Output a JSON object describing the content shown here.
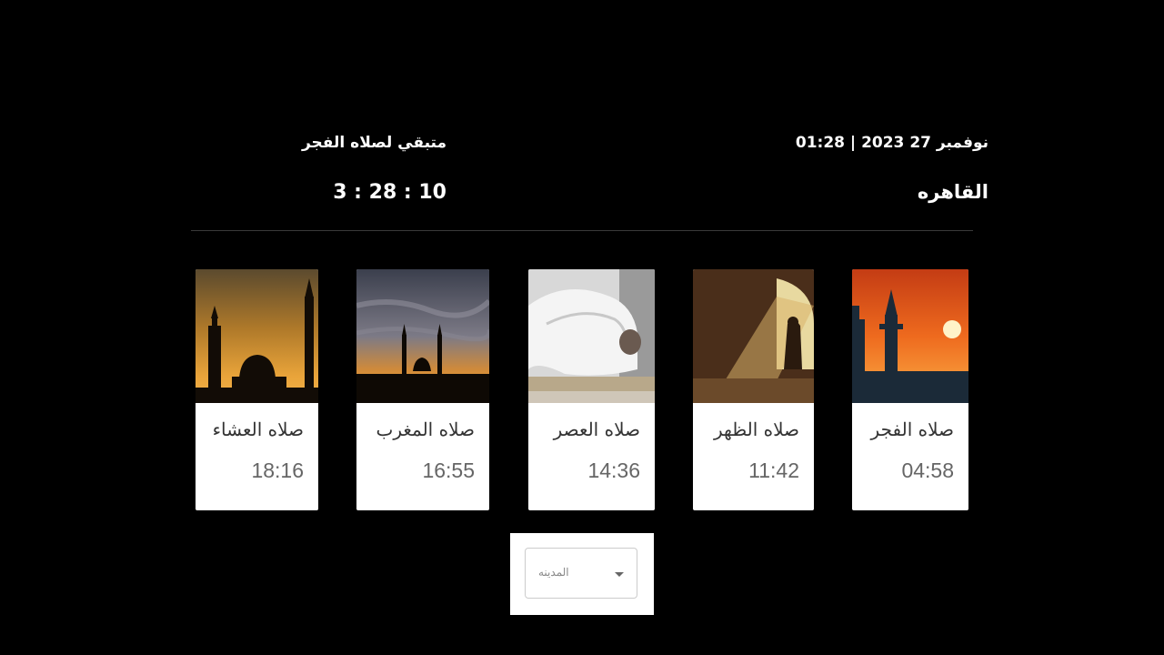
{
  "header": {
    "date_time": "نوفمبر 27 2023 | 01:28",
    "city": "القاهره",
    "remaining_label": "متبقي لصلاه الفجر",
    "countdown": "3 : 28 : 10"
  },
  "prayers": [
    {
      "name": "صلاه العشاء",
      "time": "18:16",
      "image": "mosque-dusk-photo"
    },
    {
      "name": "صلاه المغرب",
      "time": "16:55",
      "image": "mosque-sunset-photo"
    },
    {
      "name": "صلاه العصر",
      "time": "14:36",
      "image": "man-prostrating-photo"
    },
    {
      "name": "صلاه الظهر",
      "time": "11:42",
      "image": "prayer-window-light-photo"
    },
    {
      "name": "صلاه الفجر",
      "time": "04:58",
      "image": "mosque-sunrise-photo"
    }
  ],
  "city_select": {
    "placeholder": "المدينه"
  }
}
